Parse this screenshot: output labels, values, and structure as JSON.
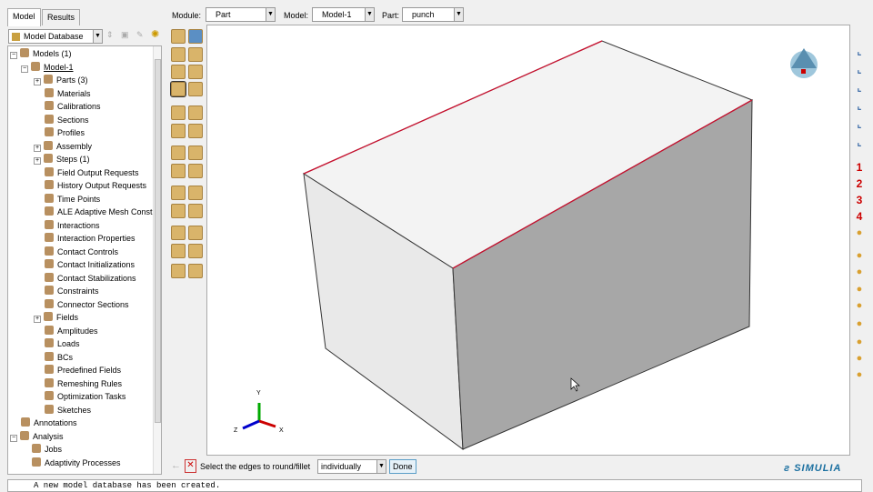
{
  "tabs": [
    "Model",
    "Results"
  ],
  "context": {
    "module_label": "Module:",
    "module": "Part",
    "model_label": "Model:",
    "model": "Model-1",
    "part_label": "Part:",
    "part": "punch"
  },
  "tree_header": {
    "database": "Model Database"
  },
  "tree": [
    {
      "label": "Models (1)",
      "level": 0,
      "exp": "−"
    },
    {
      "label": "Model-1",
      "level": 1,
      "exp": "−"
    },
    {
      "label": "Parts (3)",
      "level": 2,
      "exp": "+"
    },
    {
      "label": "Materials",
      "level": 2
    },
    {
      "label": "Calibrations",
      "level": 2
    },
    {
      "label": "Sections",
      "level": 2
    },
    {
      "label": "Profiles",
      "level": 2
    },
    {
      "label": "Assembly",
      "level": 2,
      "exp": "+"
    },
    {
      "label": "Steps (1)",
      "level": 2,
      "exp": "+"
    },
    {
      "label": "Field Output Requests",
      "level": 2
    },
    {
      "label": "History Output Requests",
      "level": 2
    },
    {
      "label": "Time Points",
      "level": 2
    },
    {
      "label": "ALE Adaptive Mesh Constra",
      "level": 2
    },
    {
      "label": "Interactions",
      "level": 2
    },
    {
      "label": "Interaction Properties",
      "level": 2
    },
    {
      "label": "Contact Controls",
      "level": 2
    },
    {
      "label": "Contact Initializations",
      "level": 2
    },
    {
      "label": "Contact Stabilizations",
      "level": 2
    },
    {
      "label": "Constraints",
      "level": 2
    },
    {
      "label": "Connector Sections",
      "level": 2
    },
    {
      "label": "Fields",
      "level": 2,
      "exp": "+"
    },
    {
      "label": "Amplitudes",
      "level": 2
    },
    {
      "label": "Loads",
      "level": 2
    },
    {
      "label": "BCs",
      "level": 2
    },
    {
      "label": "Predefined Fields",
      "level": 2
    },
    {
      "label": "Remeshing Rules",
      "level": 2
    },
    {
      "label": "Optimization Tasks",
      "level": 2
    },
    {
      "label": "Sketches",
      "level": 2
    },
    {
      "label": "Annotations",
      "level": 0
    },
    {
      "label": "Analysis",
      "level": 0,
      "exp": "−"
    },
    {
      "label": "Jobs",
      "level": 1
    },
    {
      "label": "Adaptivity Processes",
      "level": 1
    }
  ],
  "view_numbers": [
    "1",
    "2",
    "3",
    "4"
  ],
  "triad": {
    "x": "X",
    "y": "Y",
    "z": "Z"
  },
  "prompt": {
    "text": "Select the edges to round/fillet",
    "option": "individually",
    "done": "Done"
  },
  "brand": "SIMULIA",
  "message": "A new model database has been created.",
  "colors": {
    "edge_highlight": "#c8102e",
    "face_top": "#f2f2f2",
    "face_left": "#e8e8e8",
    "face_right": "#a6a6a6"
  }
}
